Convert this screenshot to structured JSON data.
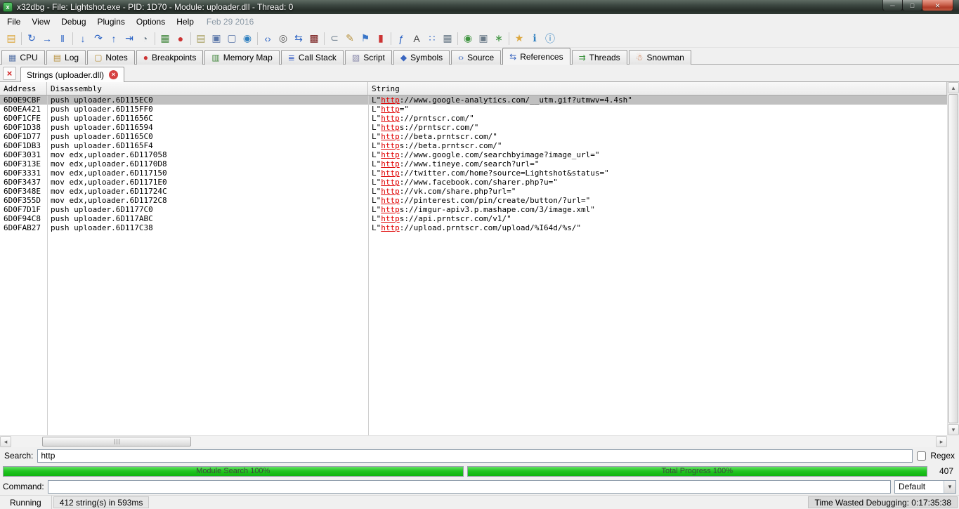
{
  "window": {
    "title": "x32dbg - File: Lightshot.exe - PID: 1D70 - Module: uploader.dll - Thread: 0",
    "app_icon_glyph": "x",
    "controls": {
      "minimize": "─",
      "maximize": "□",
      "close": "×"
    }
  },
  "menu": {
    "items": [
      "File",
      "View",
      "Debug",
      "Plugins",
      "Options",
      "Help"
    ],
    "date": "Feb 29 2016"
  },
  "toolbar": {
    "separators_before": [
      1,
      4,
      9,
      11,
      15,
      19,
      23,
      27,
      30
    ],
    "icons": [
      {
        "name": "open-file-icon",
        "glyph": "▤",
        "color": "#dca73e"
      },
      {
        "name": "restart-icon",
        "glyph": "↻",
        "color": "#2a62c4"
      },
      {
        "name": "run-icon",
        "glyph": "→",
        "color": "#2a62c4"
      },
      {
        "name": "pause-icon",
        "glyph": "‖",
        "color": "#2a62c4"
      },
      {
        "name": "step-into-icon",
        "glyph": "↓",
        "color": "#2a62c4"
      },
      {
        "name": "step-over-icon",
        "glyph": "↷",
        "color": "#2a62c4"
      },
      {
        "name": "step-out-icon",
        "glyph": "↑",
        "color": "#2a62c4"
      },
      {
        "name": "run-to-cursor-icon",
        "glyph": "⇥",
        "color": "#2a62c4"
      },
      {
        "name": "trace-icon",
        "glyph": "◔",
        "color": "#6a7a88"
      },
      {
        "name": "memory-map-icon",
        "glyph": "▦",
        "color": "#44883f"
      },
      {
        "name": "breakpoints-icon",
        "glyph": "●",
        "color": "#cc3333"
      },
      {
        "name": "log-window-icon",
        "glyph": "▤",
        "color": "#a8a060"
      },
      {
        "name": "cpu-window-icon",
        "glyph": "▣",
        "color": "#5a76a8"
      },
      {
        "name": "windows-icon",
        "glyph": "▢",
        "color": "#5a76a8"
      },
      {
        "name": "internet-icon",
        "glyph": "◉",
        "color": "#2e7fbf"
      },
      {
        "name": "source-icon",
        "glyph": "‹›",
        "color": "#2a62c4"
      },
      {
        "name": "search-icon",
        "glyph": "◎",
        "color": "#555555"
      },
      {
        "name": "references-icon",
        "glyph": "⇆",
        "color": "#2a62c4"
      },
      {
        "name": "patches-icon",
        "glyph": "▩",
        "color": "#7a2020"
      },
      {
        "name": "attach-icon",
        "glyph": "⊂",
        "color": "#708090"
      },
      {
        "name": "comment-icon",
        "glyph": "✎",
        "color": "#b8923e"
      },
      {
        "name": "label-icon",
        "glyph": "⚑",
        "color": "#3a76c8"
      },
      {
        "name": "highlight-icon",
        "glyph": "▮",
        "color": "#cc3333"
      },
      {
        "name": "functions-icon",
        "glyph": "ƒ",
        "color": "#2a62c4"
      },
      {
        "name": "text-case-icon",
        "glyph": "A",
        "color": "#444444"
      },
      {
        "name": "assembler-icon",
        "glyph": "∷",
        "color": "#2a62c4"
      },
      {
        "name": "table-icon",
        "glyph": "▦",
        "color": "#6a7a88"
      },
      {
        "name": "update-check-icon",
        "glyph": "◉",
        "color": "#3f9440"
      },
      {
        "name": "detach-windows-icon",
        "glyph": "▣",
        "color": "#6a7a88"
      },
      {
        "name": "bug-report-icon",
        "glyph": "∗",
        "color": "#3f9440"
      },
      {
        "name": "favourites-icon",
        "glyph": "★",
        "color": "#dca73e"
      },
      {
        "name": "help-icon",
        "glyph": "ℹ",
        "color": "#2e7fbf"
      },
      {
        "name": "about-icon",
        "glyph": "ⓘ",
        "color": "#2e7fbf"
      }
    ]
  },
  "tabs": {
    "active_index": 9,
    "items": [
      {
        "label": "CPU",
        "glyph": "▦",
        "color": "#5a76a8"
      },
      {
        "label": "Log",
        "glyph": "▤",
        "color": "#b8923e"
      },
      {
        "label": "Notes",
        "glyph": "▢",
        "color": "#b8923e"
      },
      {
        "label": "Breakpoints",
        "glyph": "●",
        "color": "#cc3333"
      },
      {
        "label": "Memory Map",
        "glyph": "▥",
        "color": "#44883f"
      },
      {
        "label": "Call Stack",
        "glyph": "≣",
        "color": "#4468c8"
      },
      {
        "label": "Script",
        "glyph": "▨",
        "color": "#8888aa"
      },
      {
        "label": "Symbols",
        "glyph": "◆",
        "color": "#3a66c0"
      },
      {
        "label": "Source",
        "glyph": "‹›",
        "color": "#3a66c0"
      },
      {
        "label": "References",
        "glyph": "⇆",
        "color": "#3a66c0"
      },
      {
        "label": "Threads",
        "glyph": "⇉",
        "color": "#3f9440"
      },
      {
        "label": "Snowman",
        "glyph": "☃",
        "color": "#cc6633"
      }
    ]
  },
  "subtab": {
    "label": "Strings (uploader.dll)"
  },
  "table": {
    "columns": [
      "Address",
      "Disassembly",
      "String"
    ],
    "selected_index": 0,
    "rows": [
      {
        "address": "6D0E9CBF",
        "disasm": "push uploader.6D115EC0",
        "string": "L\"http://www.google-analytics.com/__utm.gif?utmwv=4.4sh\""
      },
      {
        "address": "6D0EA421",
        "disasm": "push uploader.6D115FF0",
        "string": "L\"http=\""
      },
      {
        "address": "6D0F1CFE",
        "disasm": "push uploader.6D11656C",
        "string": "L\"http://prntscr.com/\""
      },
      {
        "address": "6D0F1D38",
        "disasm": "push uploader.6D116594",
        "string": "L\"https://prntscr.com/\""
      },
      {
        "address": "6D0F1D77",
        "disasm": "push uploader.6D1165C0",
        "string": "L\"http://beta.prntscr.com/\""
      },
      {
        "address": "6D0F1DB3",
        "disasm": "push uploader.6D1165F4",
        "string": "L\"https://beta.prntscr.com/\""
      },
      {
        "address": "6D0F3031",
        "disasm": "mov edx,uploader.6D117058",
        "string": "L\"http://www.google.com/searchbyimage?image_url=\""
      },
      {
        "address": "6D0F313E",
        "disasm": "mov edx,uploader.6D1170D8",
        "string": "L\"http://www.tineye.com/search?url=\""
      },
      {
        "address": "6D0F3331",
        "disasm": "mov edx,uploader.6D117150",
        "string": "L\"http://twitter.com/home?source=Lightshot&status=\""
      },
      {
        "address": "6D0F3437",
        "disasm": "mov edx,uploader.6D1171E0",
        "string": "L\"http://www.facebook.com/sharer.php?u=\""
      },
      {
        "address": "6D0F348E",
        "disasm": "mov edx,uploader.6D11724C",
        "string": "L\"http://vk.com/share.php?url=\""
      },
      {
        "address": "6D0F355D",
        "disasm": "mov edx,uploader.6D1172C8",
        "string": "L\"http://pinterest.com/pin/create/button/?url=\""
      },
      {
        "address": "6D0F7D1F",
        "disasm": "push uploader.6D1177C0",
        "string": "L\"https://imgur-apiv3.p.mashape.com/3/image.xml\""
      },
      {
        "address": "6D0F94C8",
        "disasm": "push uploader.6D117ABC",
        "string": "L\"https://api.prntscr.com/v1/\""
      },
      {
        "address": "6D0FAB27",
        "disasm": "push uploader.6D117C38",
        "string": "L\"http://upload.prntscr.com/upload/%I64d/%s/\""
      }
    ]
  },
  "search": {
    "label": "Search:",
    "value": "http",
    "regex_label": "Regex",
    "regex_checked": false
  },
  "progress": {
    "module": {
      "label": "Module Search 100%",
      "percent": 100
    },
    "total": {
      "label": "Total Progress 100%",
      "percent": 100
    },
    "count": "407"
  },
  "command": {
    "label": "Command:",
    "value": "",
    "profile": "Default"
  },
  "status": {
    "state": "Running",
    "message": "412 string(s) in 593ms",
    "right": "Time Wasted Debugging: 0:17:35:38"
  },
  "icons": {
    "left": "◂",
    "right": "▸",
    "up": "▴",
    "down": "▾",
    "close": "×",
    "combo_arrow": "▾"
  }
}
